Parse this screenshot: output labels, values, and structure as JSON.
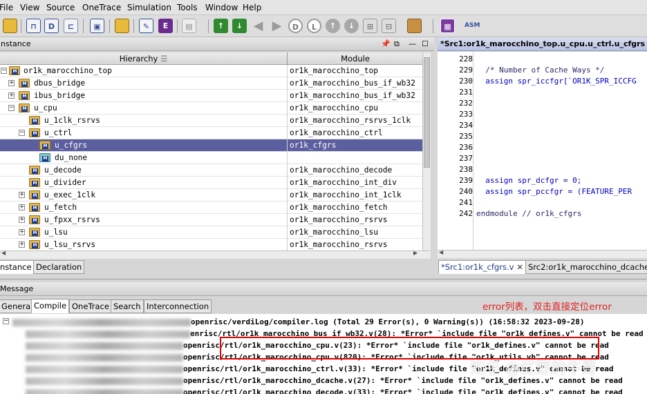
{
  "menu": [
    "File",
    "View",
    "Source",
    "OneTrace",
    "Simulation",
    "Tools",
    "Window",
    "Help"
  ],
  "toolbar_icons": [
    "open-folder-icon",
    "nlist-icon",
    "netlist-icon",
    "connect-icon",
    "schematic-icon",
    "open-file-icon",
    "edit-icon",
    "e-icon",
    "doc-icon",
    "up-green-icon",
    "down-green-icon",
    "back-arrow-icon",
    "forward-arrow-icon",
    "d-icon",
    "l-icon",
    "up-circle-icon",
    "down-circle-icon",
    "tree-icon",
    "tree2-icon",
    "bookmark-icon",
    "palette-icon",
    "asm-icon"
  ],
  "instance_panel": {
    "title": "nstance",
    "col_hierarchy": "Hierarchy",
    "col_module": "Module",
    "rows": [
      {
        "name": "or1k_marocchino_top",
        "module": "or1k_marocchino_top"
      },
      {
        "name": "dbus_bridge",
        "module": "or1k_marocchino_bus_if_wb32"
      },
      {
        "name": "ibus_bridge",
        "module": "or1k_marocchino_bus_if_wb32"
      },
      {
        "name": "u_cpu",
        "module": "or1k_marocchino_cpu"
      },
      {
        "name": "u_1clk_rsrvs",
        "module": "or1k_marocchino_rsrvs_1clk"
      },
      {
        "name": "u_ctrl",
        "module": "or1k_marocchino_ctrl"
      },
      {
        "name": "u_cfgrs",
        "module": "or1k_cfgrs"
      },
      {
        "name": "du_none",
        "module": ""
      },
      {
        "name": "u_decode",
        "module": "or1k_marocchino_decode"
      },
      {
        "name": "u_divider",
        "module": "or1k_marocchino_int_div"
      },
      {
        "name": "u_exec_1clk",
        "module": "or1k_marocchino_int_1clk"
      },
      {
        "name": "u_fetch",
        "module": "or1k_marocchino_fetch"
      },
      {
        "name": "u_fpxx_rsrvs",
        "module": "or1k_marocchino_rsrvs"
      },
      {
        "name": "u_lsu",
        "module": "or1k_marocchino_lsu"
      },
      {
        "name": "u_lsu_rsrvs",
        "module": "or1k_marocchino_rsrvs"
      }
    ],
    "tabs": [
      "nstance",
      "Declaration"
    ]
  },
  "source_panel": {
    "title": "*Src1:or1k_marocchino_top.u_cpu.u_ctrl.u_cfgrs",
    "lines": [
      {
        "n": "228",
        "t": ""
      },
      {
        "n": "229",
        "t": "  /* Number of Cache Ways */"
      },
      {
        "n": "230",
        "t": "  assign spr_iccfgr[`OR1K_SPR_ICCFG"
      },
      {
        "n": "231",
        "t": ""
      },
      {
        "n": "232",
        "t": ""
      },
      {
        "n": "233",
        "t": ""
      },
      {
        "n": "234",
        "t": ""
      },
      {
        "n": "235",
        "t": ""
      },
      {
        "n": "236",
        "t": ""
      },
      {
        "n": "237",
        "t": ""
      },
      {
        "n": "238",
        "t": ""
      },
      {
        "n": "239",
        "t": "  assign spr_dcfgr = 0;"
      },
      {
        "n": "240",
        "t": "  assign spr_pccfgr = (FEATURE_PER"
      },
      {
        "n": "241",
        "t": ""
      },
      {
        "n": "242",
        "t": "endmodule // or1k_cfgrs"
      }
    ],
    "tabs": [
      "*Src1:or1k_cfgrs.v",
      "Src2:or1k_marocchino_dcache"
    ]
  },
  "message_panel": {
    "title": "Message",
    "tabs": [
      "General",
      "Compile",
      "OneTrace",
      "Search",
      "Interconnection"
    ],
    "annotation": "error列表，双击直接定位error",
    "summary": "openrisc/verdiLog/compiler.log (Total 29 Error(s), 0 Warning(s)) (16:58:32 2023-09-28)",
    "errors": [
      "enrisc/rtl/or1k_marocchino_bus_if_wb32.v(28): *Error* `include file \"or1k_defines.v\" cannot be read",
      "openrisc/rtl/or1k_marocchino_cpu.v(23): *Error* `include file \"or1k_defines.v\" cannot be read",
      "openrisc/rtl/or1k_marocchino_cpu.v(820): *Error* `include file \"or1k_utils.vh\" cannot be read",
      "openrisc/rtl/or1k_marocchino_ctrl.v(33): *Error* `include file \"or1k_defines.v\" cannot be read",
      "openrisc/rtl/or1k_marocchino_dcache.v(27): *Error* `include file \"or1k_defines.v\" cannot be read",
      "openrisc/rtl/or1k_marocchino_decode.v(33): *Error* `include file \"or1k_defines.v\" cannot be read"
    ]
  },
  "watermark": "知乎 @红野的牛哥",
  "colors": {
    "selection": "#5b5f9f",
    "annotation_red": "#e02020",
    "highlight_box": "#e00000",
    "keyword": "#0000c0",
    "comment": "#2a2a6a"
  }
}
